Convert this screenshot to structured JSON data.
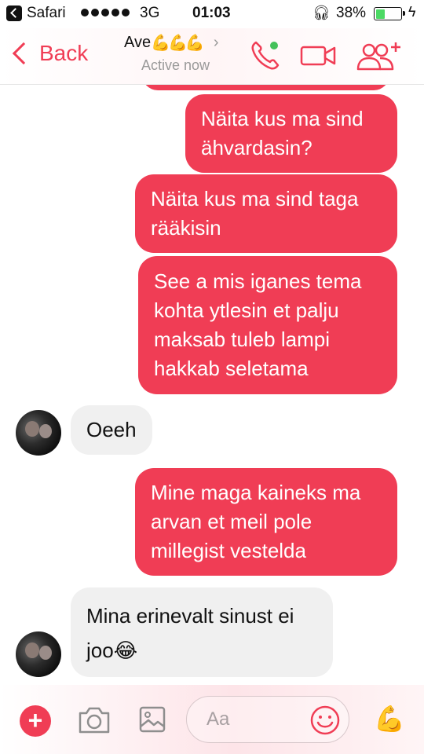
{
  "status_bar": {
    "app_name": "Safari",
    "network": "3G",
    "time": "01:03",
    "battery_percent": "38%",
    "battery_level": 0.38
  },
  "nav": {
    "back_label": "Back",
    "contact_name": "Ave",
    "contact_emoji": "💪💪💪",
    "status": "Active now",
    "accent_color": "#f03d55",
    "icons": [
      "phone-icon",
      "video-camera-icon",
      "add-people-icon"
    ]
  },
  "messages": [
    {
      "direction": "out",
      "lines": [
        "Näita kus ma sind",
        "ähvardasin?"
      ]
    },
    {
      "direction": "out",
      "lines": [
        "Näita kus ma sind taga",
        "rääkisin"
      ]
    },
    {
      "direction": "out",
      "lines": [
        "See a mis iganes tema",
        "kohta ytlesin et palju",
        "maksab tuleb lampi",
        "hakkab seletama"
      ]
    },
    {
      "direction": "in",
      "lines": [
        "Oeeh"
      ]
    },
    {
      "direction": "out",
      "lines": [
        "Mine maga kaineks ma",
        "arvan et meil pole",
        "millegist vestelda"
      ]
    },
    {
      "direction": "in",
      "lines": [
        "Mina erinevalt sinust ei",
        "joo😂"
      ]
    }
  ],
  "composer": {
    "placeholder": "Aa",
    "icons": [
      "plus-icon",
      "camera-icon",
      "gallery-icon",
      "emoji-icon",
      "flexed-biceps-icon"
    ],
    "quick_reaction": "💪"
  }
}
